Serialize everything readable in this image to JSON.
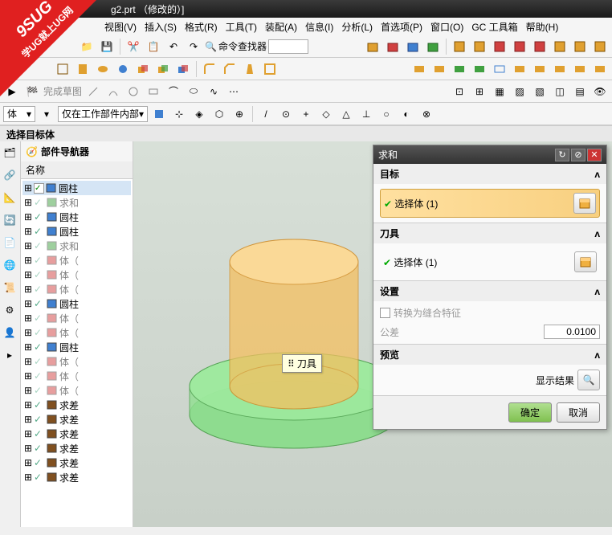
{
  "title": "g2.prt （修改的）]",
  "corner": {
    "line1": "9SUG",
    "line2": "学UG就上UG网"
  },
  "menu": [
    "视图(V)",
    "插入(S)",
    "格式(R)",
    "工具(T)",
    "装配(A)",
    "信息(I)",
    "分析(L)",
    "首选项(P)",
    "窗口(O)",
    "GC 工具箱",
    "帮助(H)"
  ],
  "cmd_finder_label": "命令查找器",
  "sketch_label": "完成草图",
  "filter_label": "仅在工作部件内部",
  "status": "选择目标体",
  "nav": {
    "title": "部件导航器",
    "col": "名称",
    "items": [
      {
        "label": "圆柱",
        "ico": "cyl",
        "chk": true,
        "sel": true
      },
      {
        "label": "求和",
        "ico": "union",
        "dim": true
      },
      {
        "label": "圆柱",
        "ico": "cyl"
      },
      {
        "label": "圆柱",
        "ico": "cyl"
      },
      {
        "label": "求和",
        "ico": "union",
        "dim": true
      },
      {
        "label": "体（",
        "ico": "body",
        "dim": true
      },
      {
        "label": "体（",
        "ico": "body",
        "dim": true
      },
      {
        "label": "体（",
        "ico": "body",
        "dim": true
      },
      {
        "label": "圆柱",
        "ico": "cyl"
      },
      {
        "label": "体（",
        "ico": "body",
        "dim": true
      },
      {
        "label": "体（",
        "ico": "body",
        "dim": true
      },
      {
        "label": "圆柱",
        "ico": "cyl"
      },
      {
        "label": "体（",
        "ico": "body",
        "dim": true
      },
      {
        "label": "体（",
        "ico": "body",
        "dim": true
      },
      {
        "label": "体（",
        "ico": "body",
        "dim": true
      },
      {
        "label": "求差",
        "ico": "sub"
      },
      {
        "label": "求差",
        "ico": "sub"
      },
      {
        "label": "求差",
        "ico": "sub"
      },
      {
        "label": "求差",
        "ico": "sub"
      },
      {
        "label": "求差",
        "ico": "sub"
      },
      {
        "label": "求差",
        "ico": "sub"
      }
    ]
  },
  "tooltip": "刀具",
  "dialog": {
    "title": "求和",
    "sections": {
      "target": {
        "title": "目标",
        "sel": "选择体 (1)"
      },
      "tool": {
        "title": "刀具",
        "sel": "选择体 (1)"
      },
      "settings": {
        "title": "设置",
        "convert": "转换为缝合特征",
        "tol_label": "公差",
        "tol": "0.0100"
      },
      "preview": {
        "title": "预览",
        "show": "显示结果"
      }
    },
    "ok": "确定",
    "cancel": "取消"
  }
}
